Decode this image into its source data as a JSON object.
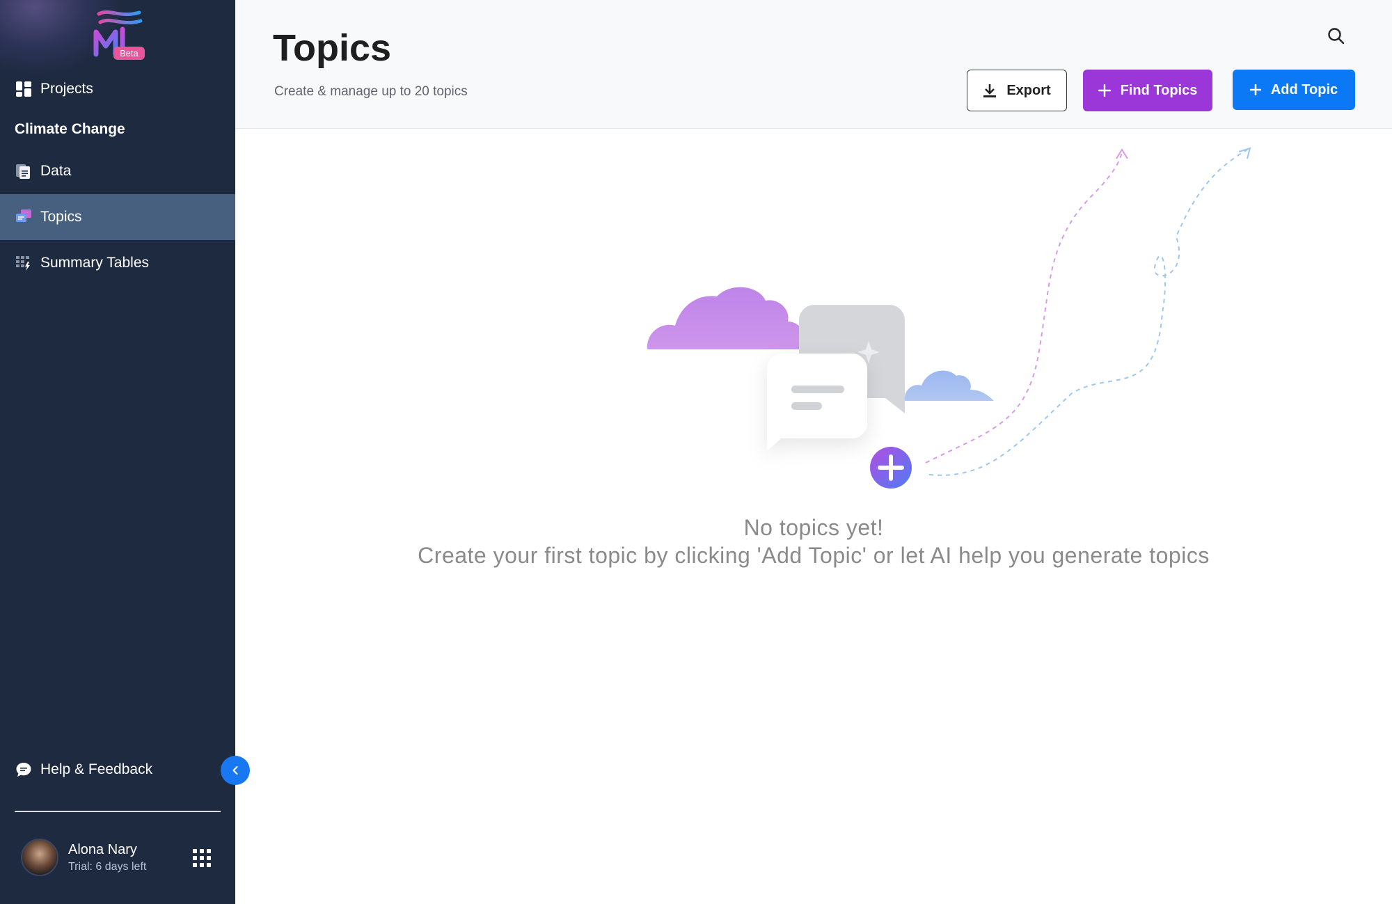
{
  "app": {
    "logo_text": "ML",
    "beta_badge": "Beta"
  },
  "sidebar": {
    "projects_label": "Projects",
    "project_name": "Climate Change",
    "items": [
      {
        "label": "Data",
        "icon": "document-icon"
      },
      {
        "label": "Topics",
        "icon": "topics-icon",
        "active": true
      },
      {
        "label": "Summary Tables",
        "icon": "table-lightning-icon"
      }
    ],
    "help_label": "Help & Feedback",
    "user": {
      "name": "Alona Nary",
      "trial": "Trial: 6 days left"
    }
  },
  "header": {
    "title": "Topics",
    "subtitle": "Create & manage up to 20 topics",
    "buttons": {
      "export": "Export",
      "find": "Find Topics",
      "add": "Add Topic"
    }
  },
  "empty_state": {
    "title": "No topics yet!",
    "description": "Create your first topic by clicking 'Add Topic' or let AI help you generate topics"
  },
  "colors": {
    "sidebar_bg": "#1e2a40",
    "sidebar_active": "#48607f",
    "find_button": "#9b37d8",
    "add_button": "#0b78f5",
    "beta_badge": "#e8559b"
  }
}
